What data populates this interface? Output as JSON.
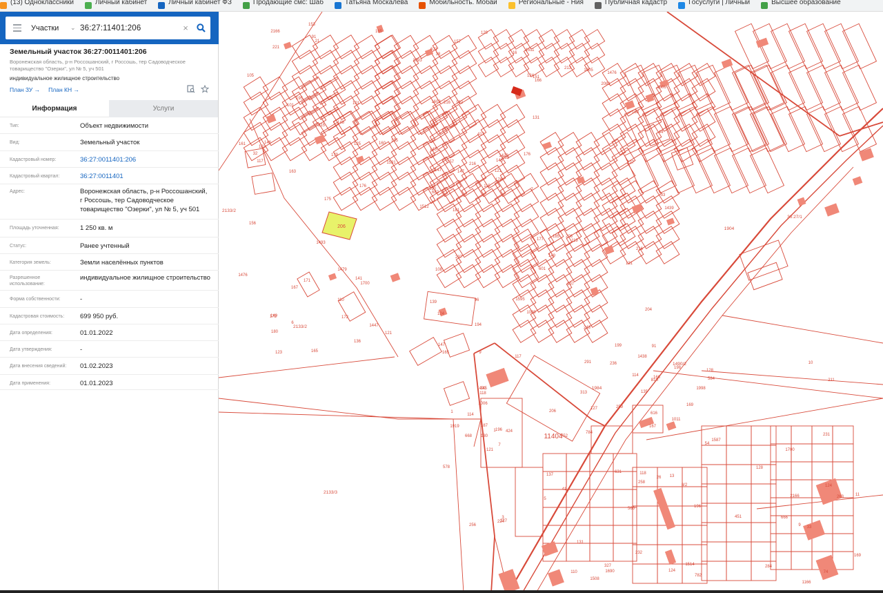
{
  "bookmarks": [
    {
      "label": "(13) Одноклассники",
      "color": "#f7931e"
    },
    {
      "label": "Личный кабинет",
      "color": "#4caf50"
    },
    {
      "label": "Личный кабинет ФЗ",
      "color": "#1565c0"
    },
    {
      "label": "Продающие смс: Шаб",
      "color": "#43a047"
    },
    {
      "label": "Татьяна Москалева",
      "color": "#1976d2"
    },
    {
      "label": "Мобильность. Мобай",
      "color": "#e65100"
    },
    {
      "label": "Региональные - Ния",
      "color": "#fbc02d"
    },
    {
      "label": "Публичная кадастр",
      "color": "#616161"
    },
    {
      "label": "Госуслуги | Личный",
      "color": "#1e88e5"
    },
    {
      "label": "Высшее образование",
      "color": "#43a047"
    }
  ],
  "search": {
    "layer": "Участки",
    "query": "36:27:11401:206"
  },
  "object": {
    "title": "Земельный участок 36:27:0011401:206",
    "address_short": "Воронежская область, р-н Россошанский, г Россошь, тер Садоводческое товарищество \"Озерки\", ул № 5, уч 501",
    "purpose": "индивидуальное жилищное строительство",
    "plan_zu": "План ЗУ →",
    "plan_kn": "План КН →"
  },
  "tabs": {
    "info": "Информация",
    "services": "Услуги"
  },
  "properties": [
    {
      "label": "Тип:",
      "value": "Объект недвижимости",
      "link": false
    },
    {
      "label": "Вид:",
      "value": "Земельный участок",
      "link": false
    },
    {
      "label": "Кадастровый номер:",
      "value": "36:27:0011401:206",
      "link": true
    },
    {
      "label": "Кадастровый квартал:",
      "value": "36:27:0011401",
      "link": true
    },
    {
      "label": "Адрес:",
      "value": "Воронежская область, р-н Россошанский, г Россошь, тер Садоводческое товарищество \"Озерки\", ул № 5, уч 501",
      "link": false
    },
    {
      "label": "Площадь уточненная:",
      "value": "1 250 кв. м",
      "link": false
    },
    {
      "label": "Статус:",
      "value": "Ранее учтенный",
      "link": false
    },
    {
      "label": "Категория земель:",
      "value": "Земли населённых пунктов",
      "link": false
    },
    {
      "label": "Разрешенное использование:",
      "value": "индивидуальное жилищное строительство",
      "link": false
    },
    {
      "label": "Форма собственности:",
      "value": "-",
      "link": false
    },
    {
      "label": "Кадастровая стоимость:",
      "value": "699 950 руб.",
      "link": false
    },
    {
      "label": "Дата определения:",
      "value": "01.01.2022",
      "link": false
    },
    {
      "label": "Дата утверждения:",
      "value": "-",
      "link": false
    },
    {
      "label": "Дата внесения сведений:",
      "value": "01.02.2023",
      "link": false
    },
    {
      "label": "Дата применения:",
      "value": "01.01.2023",
      "link": false
    }
  ],
  "map": {
    "line_color": "#d84a3a",
    "building_color": "#f08878",
    "highlight_color": "#e8f26a",
    "selected_parcel_label": "206",
    "quarter_label": "11404",
    "territory_labels": [
      "2133/2",
      "2133/2",
      "2133/3",
      "1984",
      "1904",
      "810",
      "1490/2",
      "36:27/1"
    ],
    "parcel_labels": [
      "181",
      "101",
      "682",
      "149",
      "143",
      "1700",
      "1511",
      "192",
      "151",
      "115",
      "21",
      "91",
      "163",
      "1606",
      "1512",
      "131",
      "165",
      "1603",
      "417",
      "171",
      "135",
      "180",
      "172",
      "216",
      "632",
      "119",
      "195",
      "38",
      "117",
      "177",
      "44",
      "130",
      "139",
      "147",
      "101",
      "213",
      "141",
      "199",
      "204",
      "208",
      "129",
      "160",
      "179",
      "601",
      "136",
      "161",
      "121",
      "123",
      "124",
      "178",
      "167",
      "163",
      "105",
      "149",
      "1009",
      "110",
      "91",
      "2166",
      "96",
      "1476",
      "157",
      "176",
      "146",
      "148",
      "1005",
      "153",
      "16",
      "1093",
      "157",
      "1476",
      "108",
      "121",
      "185",
      "125",
      "172",
      "221",
      "215",
      "156",
      "145",
      "194",
      "216",
      "6",
      "7",
      "216",
      "147",
      "227",
      "237",
      "243",
      "9",
      "1595",
      "671",
      "1439",
      "176",
      "197",
      "147",
      "131",
      "182",
      "165",
      "124",
      "166",
      "175",
      "165",
      "33",
      "32",
      "1493",
      "1479",
      "1447",
      "1429",
      "2081",
      "1531",
      "124",
      "118",
      "616",
      "631",
      "291",
      "256",
      "258",
      "211",
      "259",
      "236",
      "224",
      "10",
      "1011",
      "127",
      "128",
      "5",
      "74",
      "1690",
      "1700",
      "1006",
      "227",
      "782",
      "752",
      "313",
      "263",
      "666",
      "41",
      "3",
      "11",
      "784",
      "8/2",
      "7",
      "9",
      "13",
      "54",
      "245",
      "327",
      "284",
      "232",
      "114",
      "231",
      "206",
      "668",
      "1508",
      "2166",
      "198",
      "135",
      "167",
      "137",
      "169",
      "196",
      "166",
      "578",
      "1438",
      "584",
      "187",
      "566",
      "169",
      "117",
      "1166",
      "33",
      "1514",
      "1919",
      "128",
      "1587",
      "110",
      "1998",
      "451",
      "1",
      "196",
      "114",
      "26",
      "124",
      "130",
      "1491",
      "424",
      "1",
      "121",
      "131",
      "118"
    ]
  }
}
